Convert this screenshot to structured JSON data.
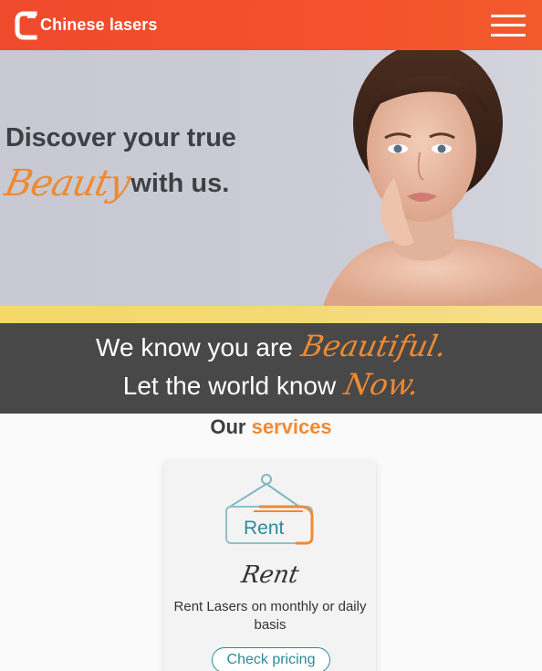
{
  "header": {
    "brand_name": "Chinese lasers",
    "logo_icon": "chinese-lasers-logo-icon",
    "menu_icon": "hamburger-menu-icon",
    "background_color": "#f04e2c"
  },
  "hero": {
    "line1": "Discover your true",
    "script_word": "Beauty",
    "line2_rest": "with us.",
    "accent_color": "#ef8a33"
  },
  "tagline": {
    "row1_text": "We know you are",
    "row1_script": "Beautiful.",
    "row2_text": "Let the world know",
    "row2_script": "Now."
  },
  "services": {
    "heading_our": "Our",
    "heading_services": "services",
    "card": {
      "icon": "rent-sign-icon",
      "icon_text": "Rent",
      "title": "Rent",
      "description": "Rent Lasers on monthly or daily basis",
      "button_label": "Check pricing"
    }
  }
}
